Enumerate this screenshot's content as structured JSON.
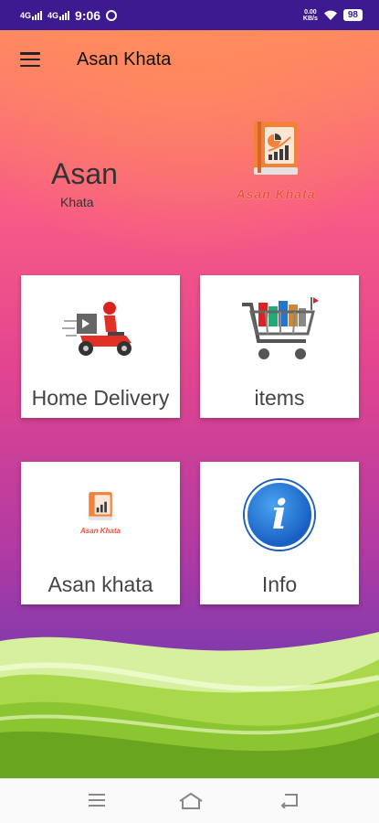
{
  "status_bar": {
    "signal1": "4G",
    "signal2": "4G",
    "time": "9:06",
    "speed_value": "0.00",
    "speed_unit": "KB/s",
    "battery": "98"
  },
  "app_bar": {
    "title": "Asan Khata",
    "menu_icon": "hamburger-icon"
  },
  "hero": {
    "main": "Asan",
    "sub": "Khata",
    "logo_caption": "Asan Khata",
    "logo_icon": "ledger-book-chart-icon"
  },
  "cards": [
    {
      "label": "Home Delivery",
      "icon": "delivery-scooter-icon"
    },
    {
      "label": "items",
      "icon": "shopping-cart-icon"
    },
    {
      "label": "Asan khata",
      "icon": "ledger-book-chart-icon",
      "icon_caption": "Asan Khata"
    },
    {
      "label": "Info",
      "icon": "info-icon",
      "icon_glyph": "i"
    }
  ],
  "nav_bar": {
    "menu": "recent-apps-icon",
    "home": "home-icon",
    "back": "back-icon"
  },
  "colors": {
    "status_bar_bg": "#3d1a8f",
    "gradient_top": "#ff8a63",
    "gradient_mid": "#e2458f",
    "gradient_bottom": "#4a36ad",
    "accent_orange": "#f04f3a",
    "info_blue": "#1860c4"
  }
}
